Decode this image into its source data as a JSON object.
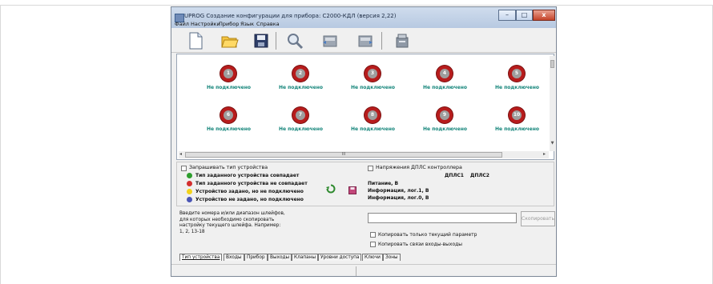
{
  "window": {
    "title": "UPROG  Создание конфигурации для прибора: С2000-КДЛ (версия  2,22)",
    "controls": {
      "minimize": "–",
      "maximize": "□",
      "close": "x"
    }
  },
  "menu": [
    "Файл",
    "Настройки",
    "Прибор",
    "Язык",
    "Справка"
  ],
  "toolbar": [
    "new-file-icon",
    "open-folder-icon",
    "save-icon",
    "search-icon",
    "read-from-device-icon",
    "write-to-device-icon",
    "device-settings-icon"
  ],
  "loops": [
    {
      "number": "1",
      "status": "Не подключено"
    },
    {
      "number": "2",
      "status": "Не подключено"
    },
    {
      "number": "3",
      "status": "Не подключено"
    },
    {
      "number": "4",
      "status": "Не подключено"
    },
    {
      "number": "5",
      "status": "Не подключено"
    },
    {
      "number": "6",
      "status": "Не подключено"
    },
    {
      "number": "7",
      "status": "Не подключено"
    },
    {
      "number": "8",
      "status": "Не подключено"
    },
    {
      "number": "9",
      "status": "Не подключено"
    },
    {
      "number": "10",
      "status": "Не подключено"
    }
  ],
  "scroll_marker": "III",
  "legend": {
    "request_type_label": "Запрашивать тип устройства",
    "items": [
      {
        "color": "#2e9e2e",
        "text": "Тип заданного устройства совпадает"
      },
      {
        "color": "#d32f2f",
        "text": "Тип заданного устройства не совпадает"
      },
      {
        "color": "#f2d21b",
        "text": "Устройство задано, но не подключено"
      },
      {
        "color": "#4a55b5",
        "text": "Устройство не задано, но подключено"
      }
    ]
  },
  "voltage": {
    "label": "Напряжения ДПЛС контроллера",
    "col1": "ДПЛС1",
    "col2": "ДПЛС2",
    "rows": [
      "Питание, В",
      "Информация, лог.1, В",
      "Информация, лог.0, В"
    ]
  },
  "copy_section": {
    "hint": "Введите номера и/или диапазон шлейфов, для которых необходимо скопировать настройку текущего шлейфа. Например: 1, 2, 13-18",
    "input_value": "",
    "copy_button": "Скопировать",
    "option_current_param": "Копировать только текущий параметр",
    "option_io_links": "Копировать связи входы-выходы"
  },
  "tabs": [
    "Тип устройства",
    "Входы",
    "Прибор",
    "Выходы",
    "Клапаны",
    "Уровни доступа",
    "Ключи",
    "Зоны"
  ]
}
